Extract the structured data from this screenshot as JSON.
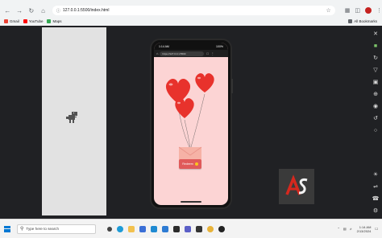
{
  "browser": {
    "url": "127.0.0.1:5500/index.html",
    "bookmarks": [
      {
        "label": "Gmail",
        "color": "#ea4335"
      },
      {
        "label": "YouTube",
        "color": "#ff0000"
      },
      {
        "label": "Maps",
        "color": "#34a853"
      }
    ],
    "all_bookmarks_label": "All Bookmarks"
  },
  "phone": {
    "status_time": "1:14 AM",
    "status_right": "100%",
    "url": "https://127.0.0.1:5500",
    "button_label": "Redeem",
    "balloon_color": "#e8322c",
    "envelope_color": "#f6b2a6"
  },
  "taskbar": {
    "search_placeholder": "Type here to search",
    "time": "1:14 AM",
    "date": "2/13/2024"
  },
  "logo": {
    "text": "AS",
    "accent": "#d6281e"
  }
}
